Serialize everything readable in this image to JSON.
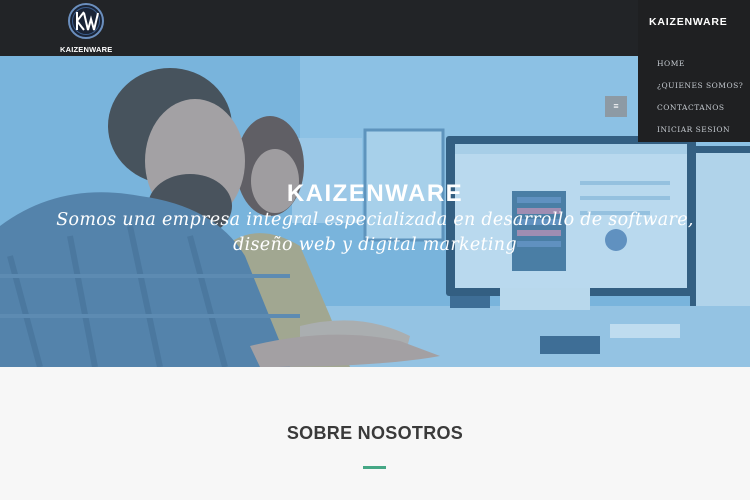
{
  "logo": {
    "text": "KAIZENWARE",
    "icon": "kw-monogram-logo"
  },
  "nav": {
    "brand": "KAIZENWARE",
    "items": [
      {
        "label": "HOME"
      },
      {
        "label": "¿QUIENES SOMOS?"
      },
      {
        "label": "CONTACTANOS"
      },
      {
        "label": "INICIAR SESION"
      }
    ],
    "toggle_symbol": "≡"
  },
  "hero": {
    "title": "KAIZENWARE",
    "subtitle_line1": "Somos una empresa integral especializada en desarrollo de software,",
    "subtitle_line2": "diseño web y digital marketing",
    "image": "people-working-at-computers-photo"
  },
  "about": {
    "title": "SOBRE NOSOTROS"
  },
  "colors": {
    "topbar": "#222427",
    "nav_panel": "#1f2022",
    "accent": "#45a785",
    "hero_tint": "#4296cd",
    "section_bg": "#f7f7f7"
  }
}
